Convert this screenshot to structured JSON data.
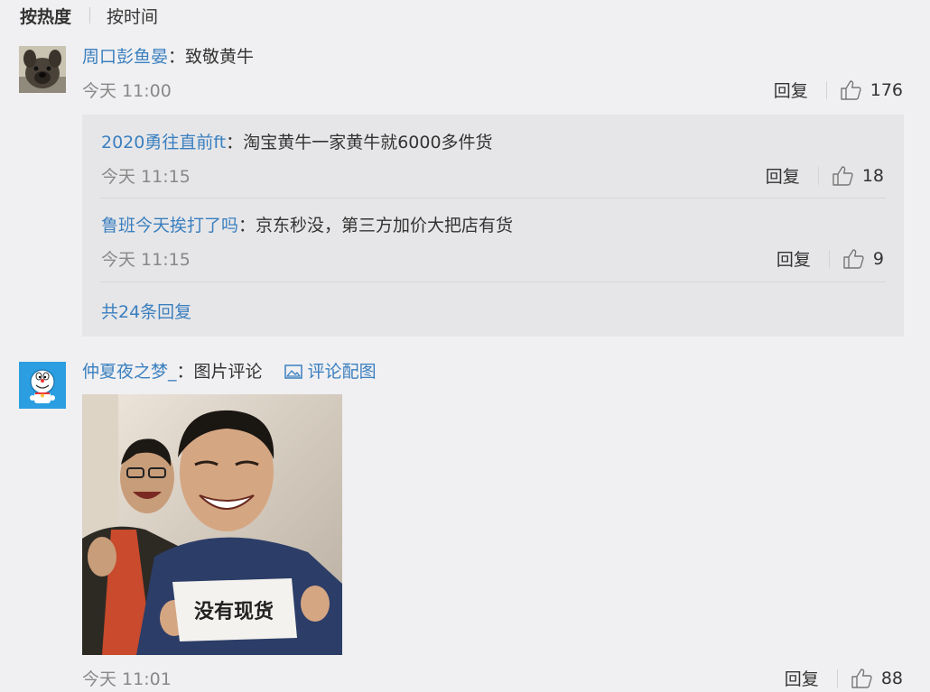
{
  "sort": {
    "active": "按热度",
    "other": "按时间"
  },
  "comments": [
    {
      "user": "周口彭鱼晏",
      "text": "致敬黄牛",
      "time": "今天 11:00",
      "reply_label": "回复",
      "likes": "176",
      "avatar_icon": "dog-avatar",
      "replies": [
        {
          "user": "2020勇往直前ft",
          "text": "淘宝黄牛一家黄牛就6000多件货",
          "time": "今天 11:15",
          "reply_label": "回复",
          "likes": "18"
        },
        {
          "user": "鲁班今天挨打了吗",
          "text": "京东秒没，第三方加价大把店有货",
          "time": "今天 11:15",
          "reply_label": "回复",
          "likes": "9"
        }
      ],
      "more_replies": "共24条回复"
    },
    {
      "user": "仲夏夜之梦_",
      "text": "图片评论",
      "image_link": "评论配图",
      "time": "今天 11:01",
      "reply_label": "回复",
      "likes": "88",
      "avatar_icon": "doraemon-avatar",
      "photo_sign_text": "没有现货"
    }
  ],
  "colors": {
    "link": "#3a7fbf",
    "background": "#f0f0f2",
    "reply_background": "#e6e6e8"
  }
}
